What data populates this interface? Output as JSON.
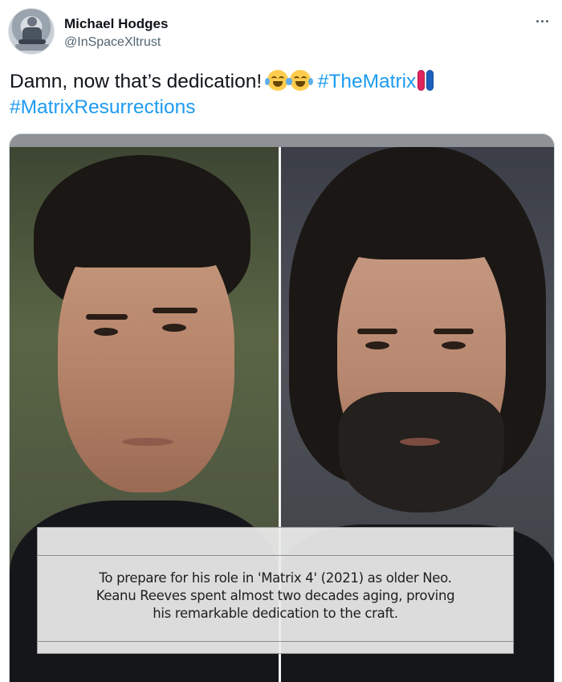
{
  "tweet": {
    "author_name": "Michael Hodges",
    "author_handle": "@InSpaceXltrust",
    "avatar_icon": "user-avatar-icon",
    "more_icon": "more-options-icon",
    "text_main": "Damn, now that’s dedication! ",
    "emojis": [
      "face-with-tears-of-joy",
      "face-with-tears-of-joy"
    ],
    "hashtag_1": "#TheMatrix",
    "pill_colors": [
      "#e0245e",
      "#1d5fbf"
    ],
    "hashtag_2": "#MatrixResurrections",
    "link_color": "#1d9bf0"
  },
  "media": {
    "caption_line_1": "To prepare for his role in 'Matrix 4' (2021) as older Neo.",
    "caption_line_2": "Keanu Reeves spent almost two decades aging, proving",
    "caption_line_3": "his remarkable dedication to the craft."
  }
}
